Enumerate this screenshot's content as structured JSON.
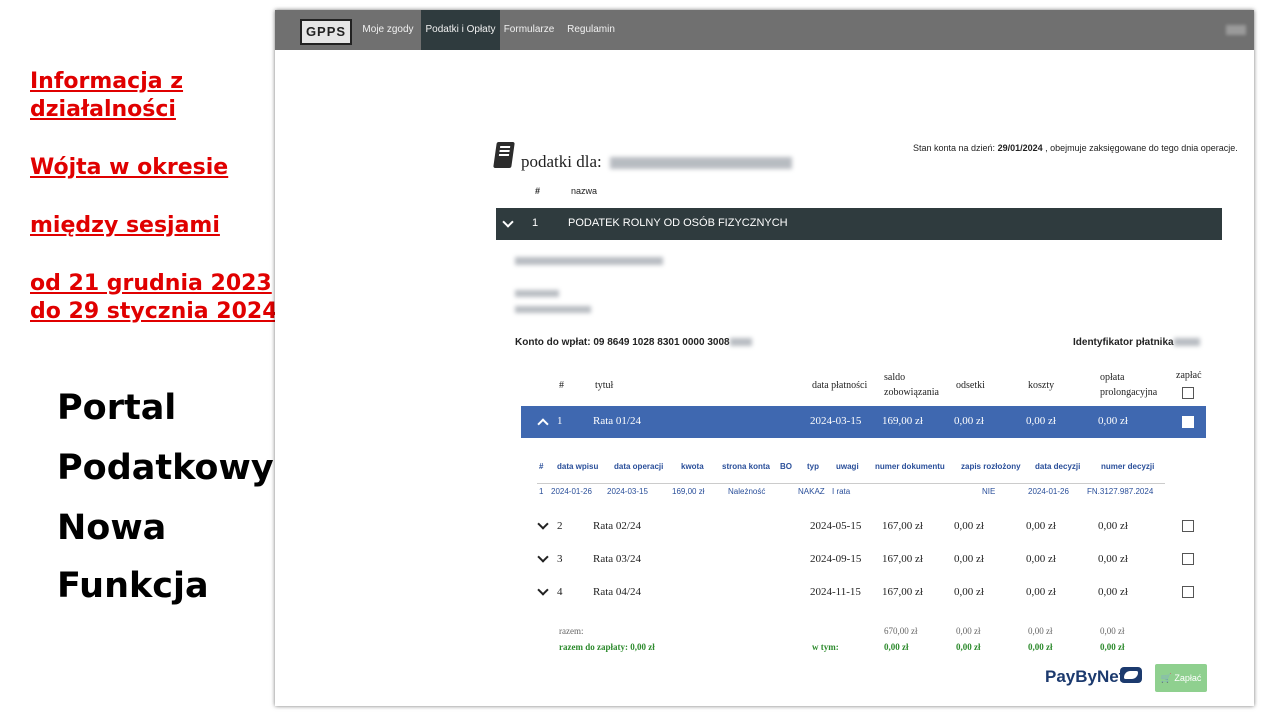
{
  "slide": {
    "red_lines": [
      "Informacja z",
      "działalności",
      "Wójta w okresie",
      "między sesjami",
      "od 21 grudnia 2023",
      "do 29 stycznia 2024"
    ],
    "black_lines": [
      "Portal",
      "Podatkowy",
      "Nowa",
      "Funkcja"
    ]
  },
  "nav": {
    "logo": "GPPS",
    "links": [
      "Moje zgody",
      "Podatki i Opłaty",
      "Formularze",
      "Regulamin"
    ],
    "active": "Podatki i Opłaty"
  },
  "header": {
    "podatki_label": "podatki dla:",
    "stan_prefix": "Stan konta na dzień:",
    "stan_date": "29/01/2024",
    "stan_suffix": ", obejmuje zaksięgowane do tego dnia operacje.",
    "col_hash": "#",
    "col_nazwa": "nazwa"
  },
  "tax": {
    "number": "1",
    "name": "PODATEK ROLNY OD OSÓB FIZYCZNYCH",
    "konto_label": "Konto do wpłat: 09 8649 1028 8301 0000 3008",
    "identyfikator_label": "Identyfikator płatnika"
  },
  "installments_header": {
    "hash": "#",
    "tytul": "tytuł",
    "data_platnosci": "data płatności",
    "saldo1": "saldo",
    "saldo2": "zobowiązania",
    "odsetki": "odsetki",
    "koszty": "koszty",
    "oplata1": "opłata",
    "oplata2": "prolongacyjna",
    "zaplac": "zapłać"
  },
  "installments": [
    {
      "n": "1",
      "tytul": "Rata 01/24",
      "data": "2024-03-15",
      "saldo": "169,00 zł",
      "odsetki": "0,00 zł",
      "koszty": "0,00 zł",
      "oplata": "0,00 zł"
    },
    {
      "n": "2",
      "tytul": "Rata 02/24",
      "data": "2024-05-15",
      "saldo": "167,00 zł",
      "odsetki": "0,00 zł",
      "koszty": "0,00 zł",
      "oplata": "0,00 zł"
    },
    {
      "n": "3",
      "tytul": "Rata 03/24",
      "data": "2024-09-15",
      "saldo": "167,00 zł",
      "odsetki": "0,00 zł",
      "koszty": "0,00 zł",
      "oplata": "0,00 zł"
    },
    {
      "n": "4",
      "tytul": "Rata 04/24",
      "data": "2024-11-15",
      "saldo": "167,00 zł",
      "odsetki": "0,00 zł",
      "koszty": "0,00 zł",
      "oplata": "0,00 zł"
    }
  ],
  "details_header": [
    "#",
    "data wpisu",
    "data operacji",
    "kwota",
    "strona konta",
    "BO",
    "typ",
    "uwagi",
    "numer dokumentu",
    "zapis rozłożony",
    "data decyzji",
    "numer decyzji"
  ],
  "details_row": [
    "1",
    "2024-01-26",
    "2024-03-15",
    "169,00 zł",
    "Należność",
    "",
    "NAKAZ",
    "I rata",
    "",
    "NIE",
    "2024-01-26",
    "FN.3127.987.2024"
  ],
  "totals": {
    "razem_label": "razem:",
    "razem_saldo": "670,00 zł",
    "razem_odsetki": "0,00 zł",
    "razem_koszty": "0,00 zł",
    "razem_oplata": "0,00 zł",
    "do_zaplaty_label": "razem do zapłaty: 0,00 zł",
    "w_tym_label": "w tym:",
    "wt_saldo": "0,00 zł",
    "wt_odsetki": "0,00 zł",
    "wt_koszty": "0,00 zł",
    "wt_oplata": "0,00 zł"
  },
  "payment": {
    "paybynet": "PayByNet",
    "button": "Zapłać"
  }
}
